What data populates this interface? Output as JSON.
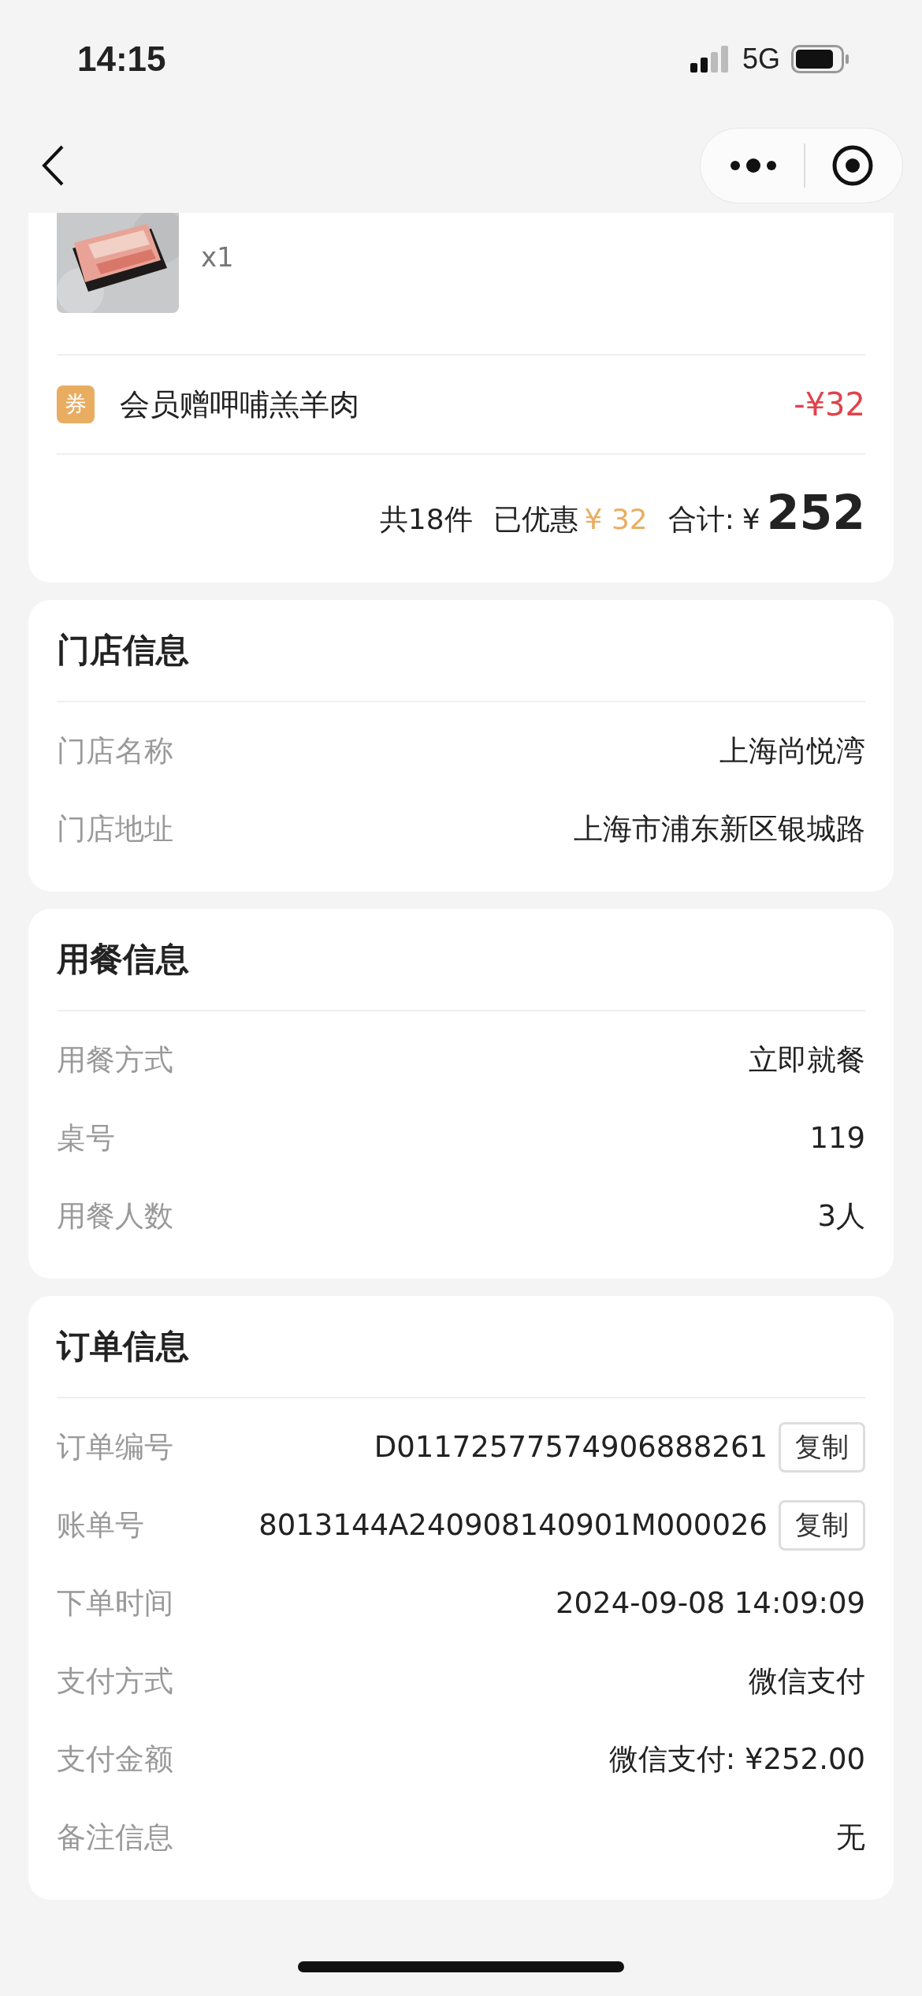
{
  "status_bar": {
    "time": "14:15",
    "network": "5G"
  },
  "product": {
    "kind": "picture",
    "quantity": "x1"
  },
  "coupon": {
    "badge": "券",
    "name": "会员赠呷哺羔羊肉",
    "amount": "-¥32"
  },
  "summary": {
    "count": "共18件",
    "discount_label": "已优惠",
    "discount": "¥ 32",
    "total_label": "合计:",
    "currency": "¥",
    "total": "252"
  },
  "sections": [
    {
      "title": "门店信息",
      "rows": [
        {
          "label": "门店名称",
          "value": "上海尚悦湾"
        },
        {
          "label": "门店地址",
          "value": "上海市浦东新区银城路"
        }
      ]
    },
    {
      "title": "用餐信息",
      "rows": [
        {
          "label": "用餐方式",
          "value": "立即就餐"
        },
        {
          "label": "桌号",
          "value": "119"
        },
        {
          "label": "用餐人数",
          "value": "3人"
        }
      ]
    },
    {
      "title": "订单信息",
      "rows": [
        {
          "label": "订单编号",
          "value": "D01172577574906888261",
          "action": "复制"
        },
        {
          "label": "账单号",
          "value": "8013144A240908140901M000026",
          "action": "复制"
        },
        {
          "label": "下单时间",
          "value": "2024-09-08 14:09:09"
        },
        {
          "label": "支付方式",
          "value": "微信支付"
        },
        {
          "label": "支付金额",
          "value": "微信支付: ¥252.00"
        },
        {
          "label": "备注信息",
          "value": "无"
        }
      ]
    }
  ]
}
